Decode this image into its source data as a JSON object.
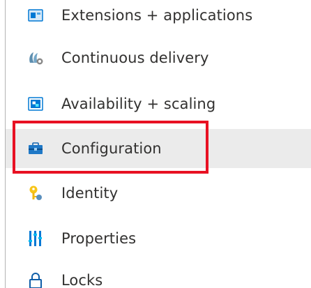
{
  "menu": {
    "items": [
      {
        "label": "Extensions + applications",
        "icon": "extensions-icon"
      },
      {
        "label": "Continuous delivery",
        "icon": "continuous-delivery-icon"
      },
      {
        "label": "Availability + scaling",
        "icon": "availability-scaling-icon"
      },
      {
        "label": "Configuration",
        "icon": "configuration-toolbox-icon",
        "selected": true
      },
      {
        "label": "Identity",
        "icon": "identity-key-icon"
      },
      {
        "label": "Properties",
        "icon": "properties-icon"
      },
      {
        "label": "Locks",
        "icon": "lock-icon"
      }
    ]
  },
  "colors": {
    "highlight": "#e81123",
    "selected_background": "#ebebeb",
    "text": "#323130",
    "accent_blue": "#0078d4"
  }
}
